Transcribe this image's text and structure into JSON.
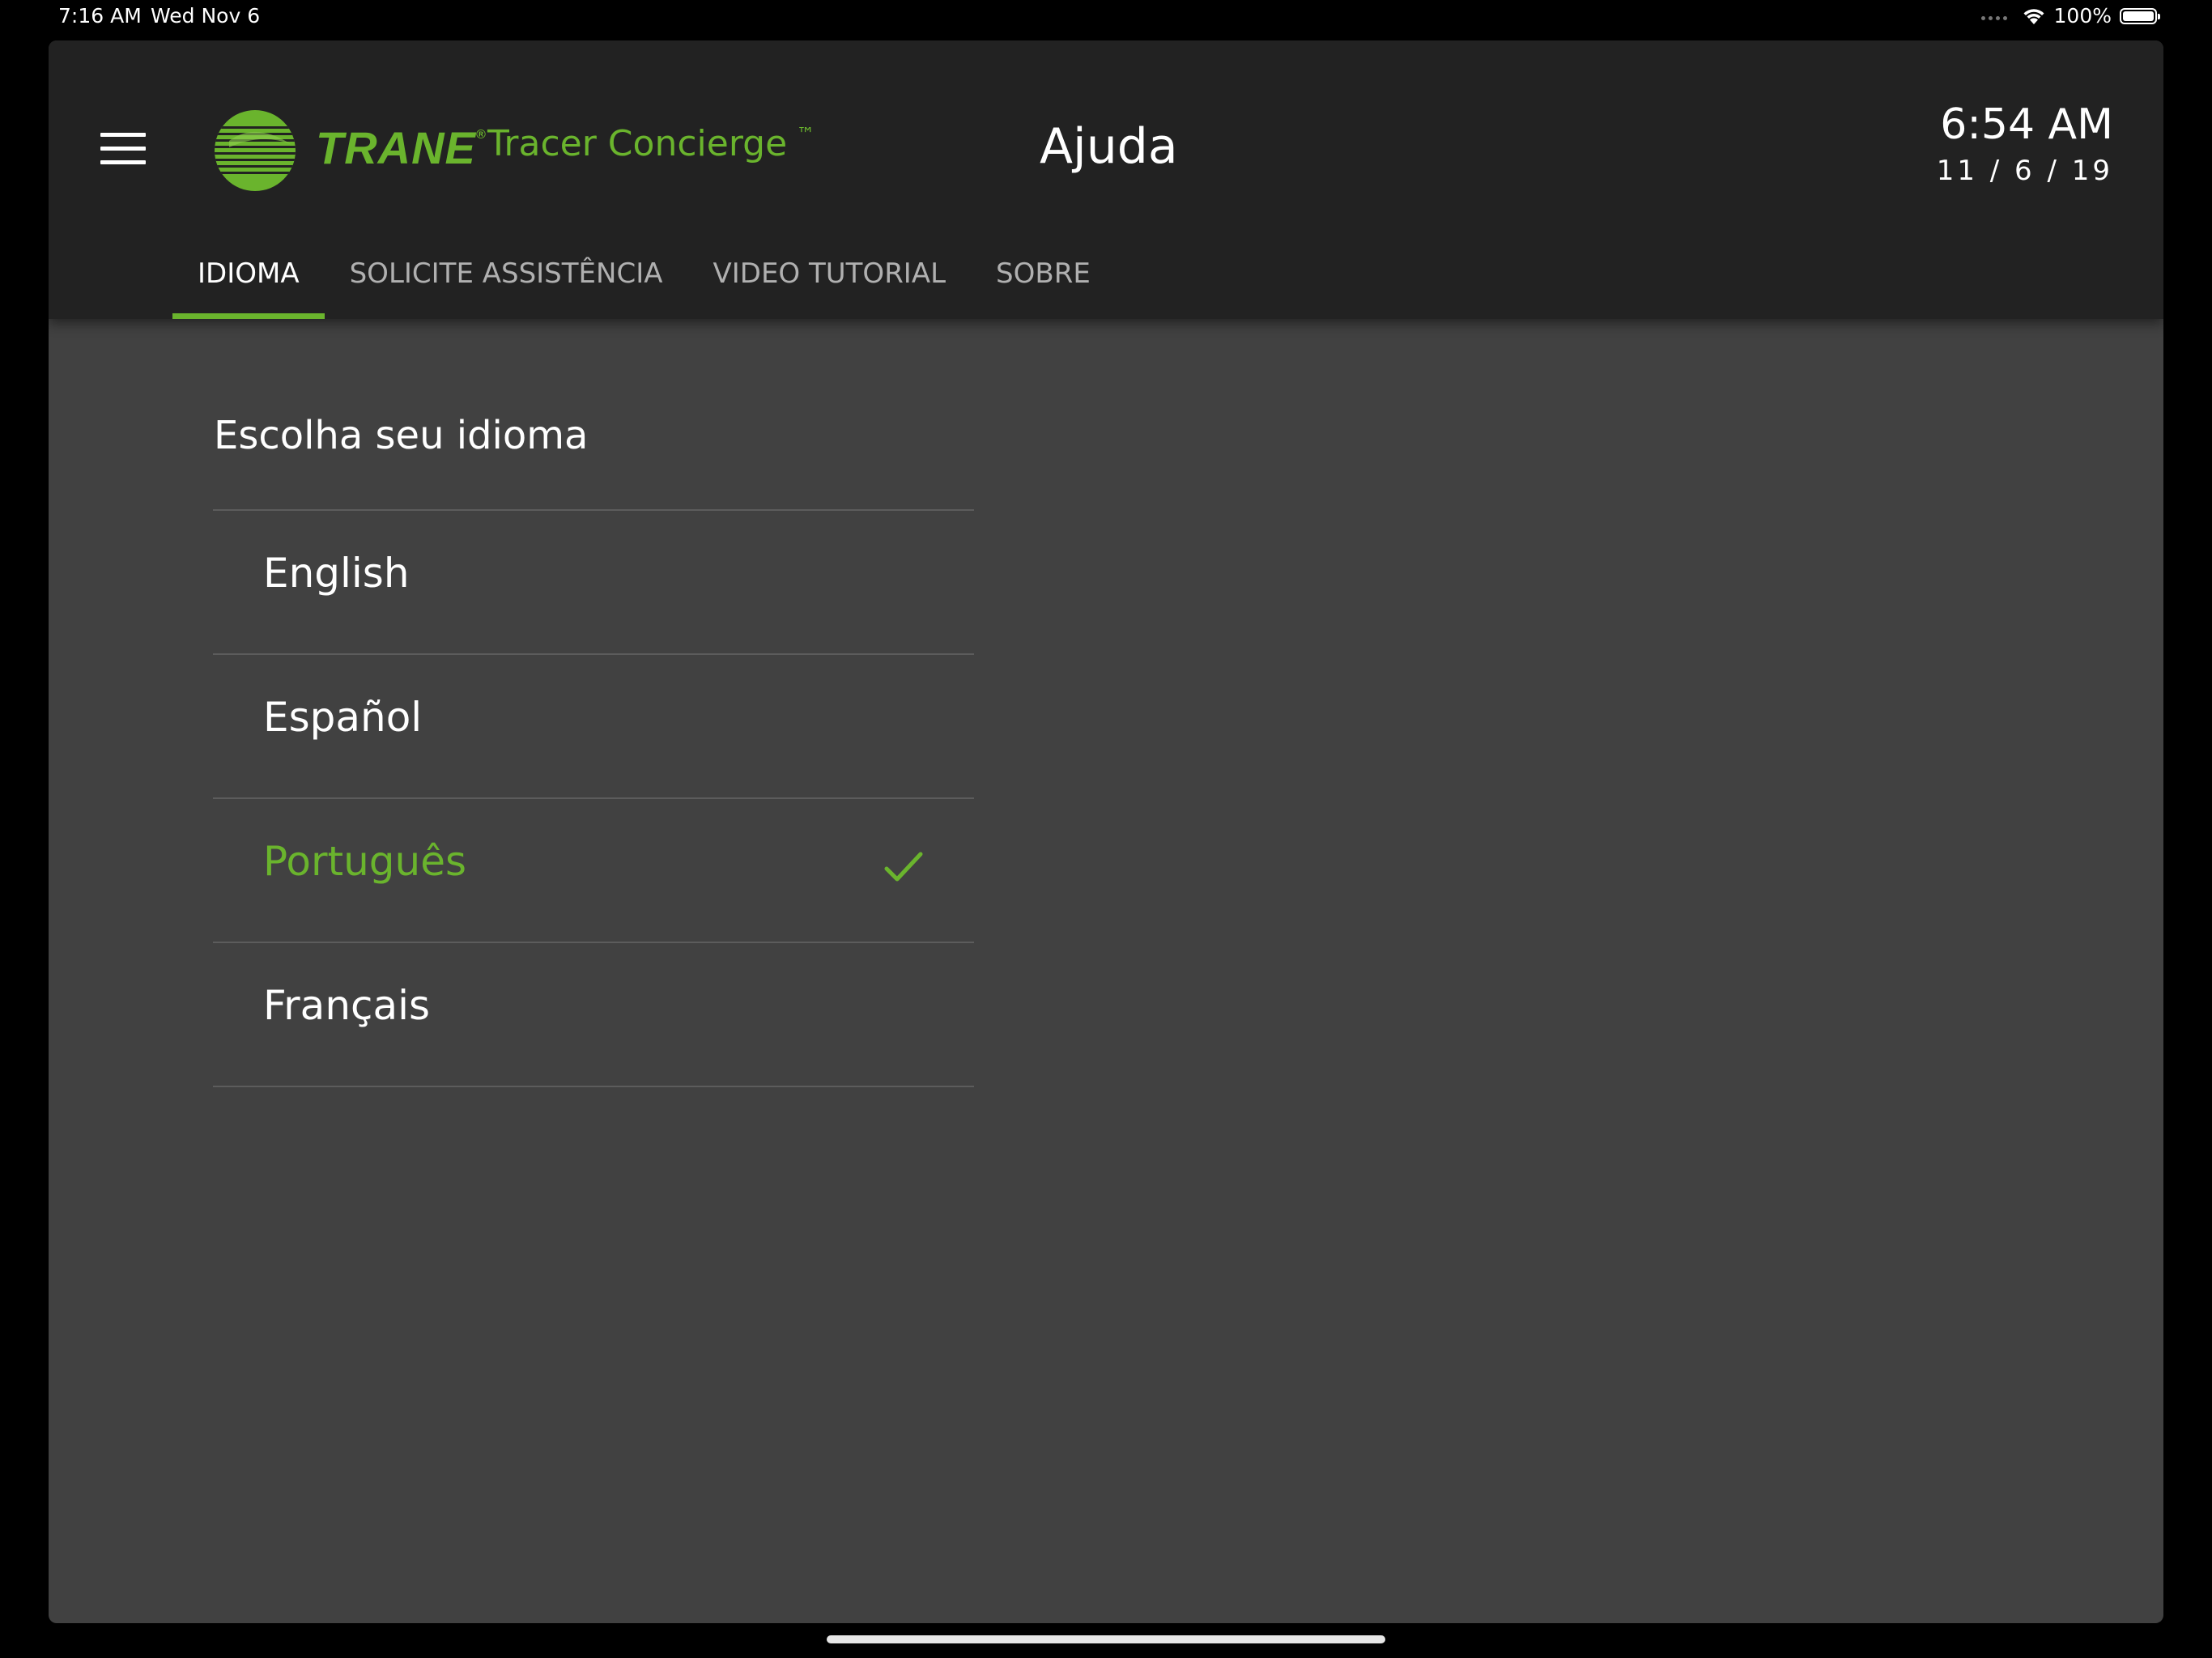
{
  "status_bar": {
    "time": "7:16 AM",
    "date": "Wed Nov 6",
    "battery": "100%",
    "icons": [
      "signal-dots-icon",
      "wifi-icon",
      "battery-icon"
    ]
  },
  "header": {
    "brand": "TRANE",
    "brand_mark": "®",
    "product": "Tracer Concierge",
    "product_mark": "™",
    "title": "Ajuda",
    "clock_time": "6:54 AM",
    "clock_date": "11 / 6 / 19",
    "accent_color": "#6ab42d"
  },
  "tabs": [
    {
      "label": "IDIOMA",
      "active": true
    },
    {
      "label": "SOLICITE ASSISTÊNCIA",
      "active": false
    },
    {
      "label": "VIDEO TUTORIAL",
      "active": false
    },
    {
      "label": "SOBRE",
      "active": false
    }
  ],
  "language": {
    "heading": "Escolha seu idioma",
    "options": [
      {
        "label": "English",
        "selected": false
      },
      {
        "label": "Español",
        "selected": false
      },
      {
        "label": "Português",
        "selected": true
      },
      {
        "label": "Français",
        "selected": false
      }
    ]
  }
}
